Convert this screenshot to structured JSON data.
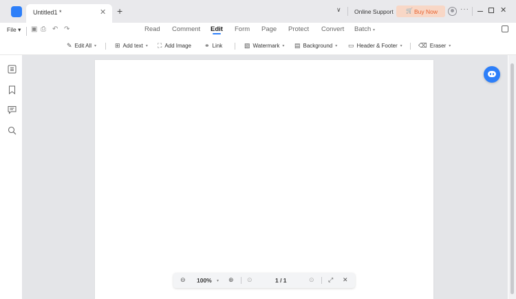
{
  "titlebar": {
    "tab_title": "Untitled1 *",
    "online_support": "Online Support",
    "buy_now": "Buy Now"
  },
  "menu": {
    "file": "File",
    "tabs": [
      "Read",
      "Comment",
      "Edit",
      "Form",
      "Page",
      "Protect",
      "Convert",
      "Batch"
    ],
    "active_tab": "Edit"
  },
  "toolbar": {
    "edit_all": "Edit All",
    "add_text": "Add text",
    "add_image": "Add Image",
    "link": "Link",
    "watermark": "Watermark",
    "background": "Background",
    "header_footer": "Header & Footer",
    "eraser": "Eraser"
  },
  "zoom": {
    "level": "100%",
    "page_indicator": "1 / 1"
  },
  "colors": {
    "accent": "#2d7ff9",
    "buy_now_bg": "#f8d7c6",
    "buy_now_text": "#e8622e",
    "canvas_bg": "#e4e5e8"
  },
  "icons": {
    "sidebar": [
      "thumbnails-icon",
      "bookmark-icon",
      "comments-icon",
      "search-icon"
    ]
  }
}
